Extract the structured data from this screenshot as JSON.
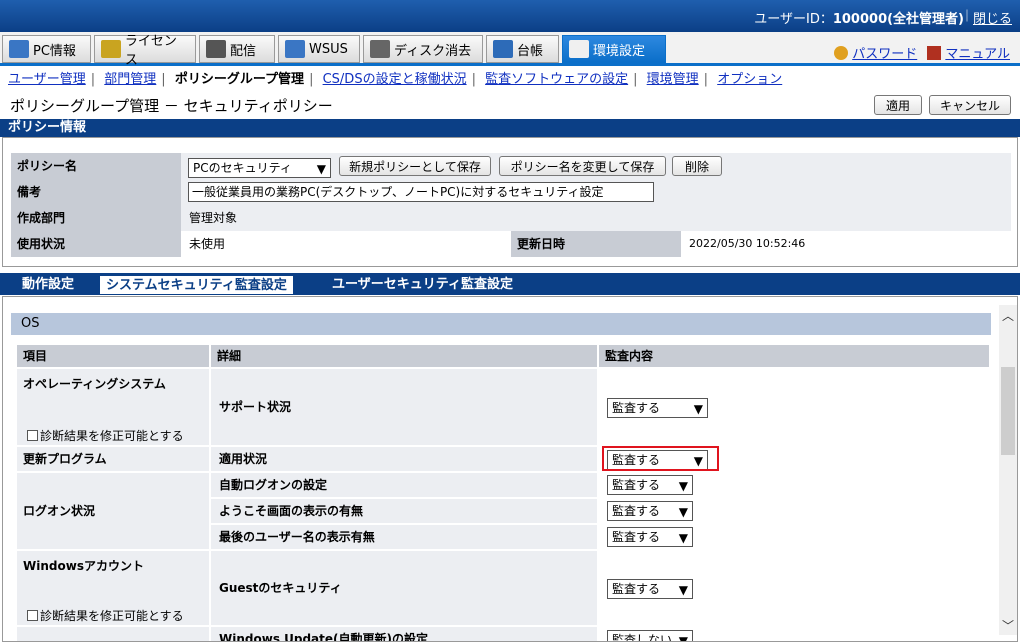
{
  "topbar": {
    "user_label": "ユーザーID：",
    "user_value": "100000(全社管理者)",
    "sep": "｜",
    "close": "閉じる"
  },
  "tabs": [
    {
      "label": "PC情報",
      "color": "#3a76c4"
    },
    {
      "label": "ライセンス",
      "color": "#c9a420"
    },
    {
      "label": "配信",
      "color": "#555555"
    },
    {
      "label": "WSUS",
      "color": "#3a76c4"
    },
    {
      "label": "ディスク消去",
      "color": "#666666"
    },
    {
      "label": "台帳",
      "color": "#2d6bb8"
    },
    {
      "label": "環境設定",
      "color": "#f0f0f0"
    }
  ],
  "right_links": {
    "password": "パスワード",
    "manual": "マニュアル"
  },
  "subnav": {
    "items": [
      "ユーザー管理",
      "部門管理",
      "ポリシーグループ管理",
      "CS/DSの設定と稼働状況",
      "監査ソフトウェアの設定",
      "環境管理",
      "オプション"
    ],
    "bar": "|"
  },
  "page_title": "ポリシーグループ管理 － セキュリティポリシー",
  "buttons": {
    "apply": "適用",
    "cancel": "キャンセル",
    "save_new": "新規ポリシーとして保存",
    "rename": "ポリシー名を変更して保存",
    "delete": "削除"
  },
  "policy_info": {
    "header": "ポリシー情報",
    "name_label": "ポリシー名",
    "name_value": "PCのセキュリティ",
    "note_label": "備考",
    "note_value": "一般従業員用の業務PC(デスクトップ、ノートPC)に対するセキュリティ設定",
    "dept_label": "作成部門",
    "dept_value": "管理対象",
    "status_label": "使用状況",
    "status_value": "未使用",
    "updated_label": "更新日時",
    "updated_value": "2022/05/30 10:52:46"
  },
  "setting_tabs": [
    "動作設定",
    "システムセキュリティ監査設定",
    "ユーザーセキュリティ監査設定"
  ],
  "os_section": "OS",
  "table": {
    "headers": [
      "項目",
      "詳細",
      "監査内容"
    ],
    "checkbox_label": "診断結果を修正可能とする",
    "rows": {
      "os": {
        "item": "オペレーティングシステム",
        "detail": "サポート状況",
        "value": "監査する"
      },
      "update": {
        "item": "更新プログラム",
        "detail": "適用状況",
        "value": "監査する"
      },
      "logon": {
        "item": "ログオン状況",
        "d1": "自動ログオンの設定",
        "d2": "ようこそ画面の表示の有無",
        "d3": "最後のユーザー名の表示有無",
        "value": "監査する"
      },
      "account": {
        "item": "Windowsアカウント",
        "detail": "Guestのセキュリティ",
        "value": "監査する"
      },
      "wu": {
        "detail": "Windows Update(自動更新)の設定",
        "value": "監査しない"
      }
    }
  },
  "chevron": "❯",
  "scroll": {
    "up": "︿",
    "down": "﹀"
  }
}
